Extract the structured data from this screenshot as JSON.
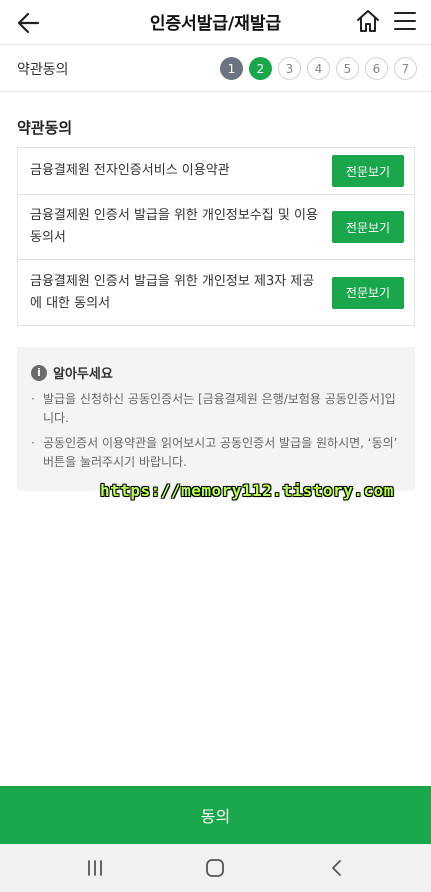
{
  "header": {
    "title": "인증서발급/재발급"
  },
  "step_bar": {
    "label": "약관동의",
    "steps": [
      "1",
      "2",
      "3",
      "4",
      "5",
      "6",
      "7"
    ],
    "current_step": 2
  },
  "section": {
    "title": "약관동의"
  },
  "terms": [
    {
      "text": "금융결제원 전자인증서비스 이용약관",
      "button": "전문보기"
    },
    {
      "text": "금융결제원 인증서 발급을 위한 개인정보수집 및 이용 동의서",
      "button": "전문보기"
    },
    {
      "text": "금융결제원 인증서 발급을 위한 개인정보 제3자 제공에 대한 동의서",
      "button": "전문보기"
    }
  ],
  "notice": {
    "title": "알아두세요",
    "items": [
      "발급을 신청하신 공동인증서는 [금융결제원 은행/보험용 공동인증서]입니다.",
      "공동인증서 이용약관을 읽어보시고 공동인증서 발급을 원하시면, ‘동의’ 버튼을 눌러주시기 바랍니다."
    ]
  },
  "watermark": "https://memory112.tistory.com",
  "agree_button": "동의",
  "colors": {
    "accent": "#1aa64a",
    "step_done": "#6b7480",
    "notice_bg": "#f4f4f4"
  }
}
